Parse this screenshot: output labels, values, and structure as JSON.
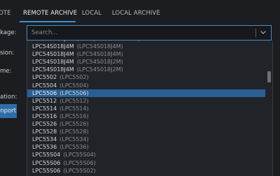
{
  "tabs": [
    {
      "label": "OTE"
    },
    {
      "label": "REMOTE ARCHIVE"
    },
    {
      "label": "LOCAL"
    },
    {
      "label": "LOCAL ARCHIVE"
    }
  ],
  "form_labels": {
    "package": "kage:",
    "version": "sion:",
    "name": "me:",
    "location": "ation:"
  },
  "import_button": "nport",
  "combo": {
    "placeholder": "Search..."
  },
  "list": [
    {
      "name": "LPC54S018J4M",
      "sub": "(LPCXpresso54S018M)"
    },
    {
      "name": "LPC54S018J4M",
      "sub": "(LPC54S018J4M)"
    },
    {
      "name": "LPC54S018J4M",
      "sub": "(LPC54S018J4M)"
    },
    {
      "name": "LPC54S018J4M",
      "sub": "(LPC54S018J2M)"
    },
    {
      "name": "LPC54S018J4M",
      "sub": "(LPC54S018J2M)"
    },
    {
      "name": "LPC5502",
      "sub": "(LPC5502)"
    },
    {
      "name": "LPC5504",
      "sub": "(LPC5504)"
    },
    {
      "name": "LPC5506",
      "sub": "(LPC5506)"
    },
    {
      "name": "LPC5512",
      "sub": "(LPC5512)"
    },
    {
      "name": "LPC5514",
      "sub": "(LPC5514)"
    },
    {
      "name": "LPC5516",
      "sub": "(LPC5516)"
    },
    {
      "name": "LPC5526",
      "sub": "(LPC5526)"
    },
    {
      "name": "LPC5528",
      "sub": "(LPC5528)"
    },
    {
      "name": "LPC5534",
      "sub": "(LPC5534)"
    },
    {
      "name": "LPC5536",
      "sub": "(LPC5536)"
    },
    {
      "name": "LPC55S04",
      "sub": "(LPC55S04)"
    },
    {
      "name": "LPC55S06",
      "sub": "(LPC55S06)"
    },
    {
      "name": "LPC55S06",
      "sub": "(LPC55S02)"
    }
  ],
  "selected_index": 7,
  "icons": {
    "combo_arrow": "chevron-down-icon"
  },
  "colors": {
    "accent": "#3f8fd0",
    "selection": "#2a5f92",
    "background": "#1b1d20"
  }
}
